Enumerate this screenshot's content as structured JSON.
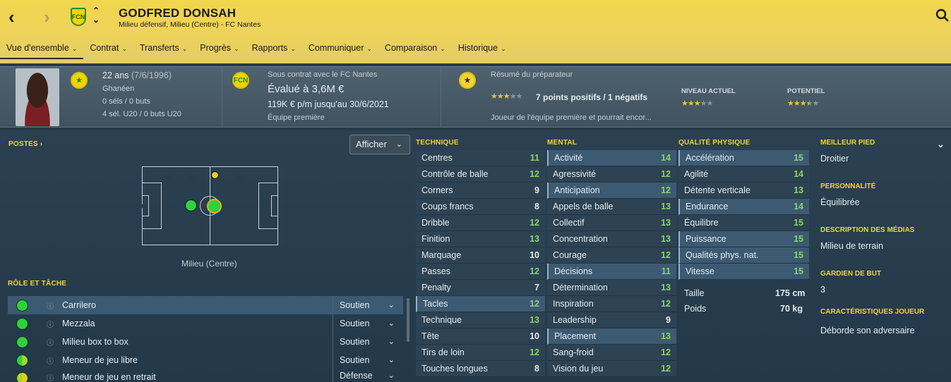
{
  "header": {
    "name": "GODFRED DONSAH",
    "subtitle": "Milieu défensif, Milieu (Centre) - FC Nantes",
    "crest": "fc-nantes-crest",
    "back_icon": "chevron-left-icon",
    "forward_icon": "chevron-right-icon",
    "search_icon": "search-icon"
  },
  "menu": [
    {
      "label": "Vue d'ensemble",
      "active": true
    },
    {
      "label": "Contrat"
    },
    {
      "label": "Transferts"
    },
    {
      "label": "Progrès"
    },
    {
      "label": "Rapports"
    },
    {
      "label": "Communiquer"
    },
    {
      "label": "Comparaison"
    },
    {
      "label": "Historique"
    }
  ],
  "info": {
    "age": "22 ans",
    "dob": "(7/6/1996)",
    "nationality": "Ghanéen",
    "caps": "0 séls / 0 buts",
    "u20": "4 sél. U20 / 0 buts U20",
    "contract": "Sous contrat avec le FC Nantes",
    "value": "Évalué à 3,6M €",
    "wage": "119K € p/m jusqu'au 30/6/2021",
    "squad": "Équipe première",
    "report_title": "Résumé du préparateur",
    "report_points": "7 points positifs / 1 négatifs",
    "report_text": "Joueur de l'équipe première et pourrait encor...",
    "current_label": "NIVEAU ACTUEL",
    "potential_label": "POTENTIEL",
    "report_stars": 3,
    "current_stars": 3,
    "potential_stars": 3.5
  },
  "positions": {
    "label": "POSTES",
    "show_button": "Afficher",
    "caption": "Milieu (Centre)"
  },
  "roles": {
    "label": "RÔLE ET TÂCHE",
    "items": [
      {
        "name": "Carrilero",
        "duty": "Soutien"
      },
      {
        "name": "Mezzala",
        "duty": "Soutien"
      },
      {
        "name": "Milieu box to box",
        "duty": "Soutien"
      },
      {
        "name": "Meneur de jeu libre",
        "duty": "Soutien"
      },
      {
        "name": "Meneur de jeu en retrait",
        "duty": "Défense"
      }
    ]
  },
  "technique": {
    "title": "TECHNIQUE",
    "rows": [
      {
        "n": "Centres",
        "v": "11"
      },
      {
        "n": "Contrôle de balle",
        "v": "12"
      },
      {
        "n": "Corners",
        "v": "9"
      },
      {
        "n": "Coups francs",
        "v": "8"
      },
      {
        "n": "Dribble",
        "v": "12"
      },
      {
        "n": "Finition",
        "v": "13"
      },
      {
        "n": "Marquage",
        "v": "10"
      },
      {
        "n": "Passes",
        "v": "12"
      },
      {
        "n": "Penalty",
        "v": "7"
      },
      {
        "n": "Tacles",
        "v": "12"
      },
      {
        "n": "Technique",
        "v": "13"
      },
      {
        "n": "Tête",
        "v": "10"
      },
      {
        "n": "Tirs de loin",
        "v": "12"
      },
      {
        "n": "Touches longues",
        "v": "8"
      }
    ]
  },
  "mental": {
    "title": "MENTAL",
    "rows": [
      {
        "n": "Activité",
        "v": "14"
      },
      {
        "n": "Agressivité",
        "v": "12"
      },
      {
        "n": "Anticipation",
        "v": "12"
      },
      {
        "n": "Appels de balle",
        "v": "13"
      },
      {
        "n": "Collectif",
        "v": "13"
      },
      {
        "n": "Concentration",
        "v": "13"
      },
      {
        "n": "Courage",
        "v": "12"
      },
      {
        "n": "Décisions",
        "v": "11"
      },
      {
        "n": "Détermination",
        "v": "13"
      },
      {
        "n": "Inspiration",
        "v": "12"
      },
      {
        "n": "Leadership",
        "v": "9"
      },
      {
        "n": "Placement",
        "v": "13"
      },
      {
        "n": "Sang-froid",
        "v": "12"
      },
      {
        "n": "Vision du jeu",
        "v": "12"
      }
    ]
  },
  "physical": {
    "title": "QUALITÉ PHYSIQUE",
    "rows": [
      {
        "n": "Accélération",
        "v": "15"
      },
      {
        "n": "Agilité",
        "v": "14"
      },
      {
        "n": "Détente verticale",
        "v": "13"
      },
      {
        "n": "Endurance",
        "v": "14"
      },
      {
        "n": "Équilibre",
        "v": "15"
      },
      {
        "n": "Puissance",
        "v": "15"
      },
      {
        "n": "Qualités phys. nat.",
        "v": "15"
      },
      {
        "n": "Vitesse",
        "v": "15"
      }
    ],
    "height_label": "Taille",
    "height": "175 cm",
    "weight_label": "Poids",
    "weight": "70 kg"
  },
  "right": [
    {
      "label": "MEILLEUR PIED",
      "value": "Droitier"
    },
    {
      "label": "PERSONNALITÉ",
      "value": "Équilibrée"
    },
    {
      "label": "DESCRIPTION DES MÉDIAS",
      "value": "Milieu de terrain"
    },
    {
      "label": "GARDIEN DE BUT",
      "value": "3"
    },
    {
      "label": "CARACTÉRISTIQUES JOUEUR",
      "value": "Déborde son adversaire"
    }
  ],
  "colors": {
    "header": "#f1d64e",
    "accent": "#f5d335",
    "green": "#8fd46a",
    "highlight": "#3c5a72"
  }
}
